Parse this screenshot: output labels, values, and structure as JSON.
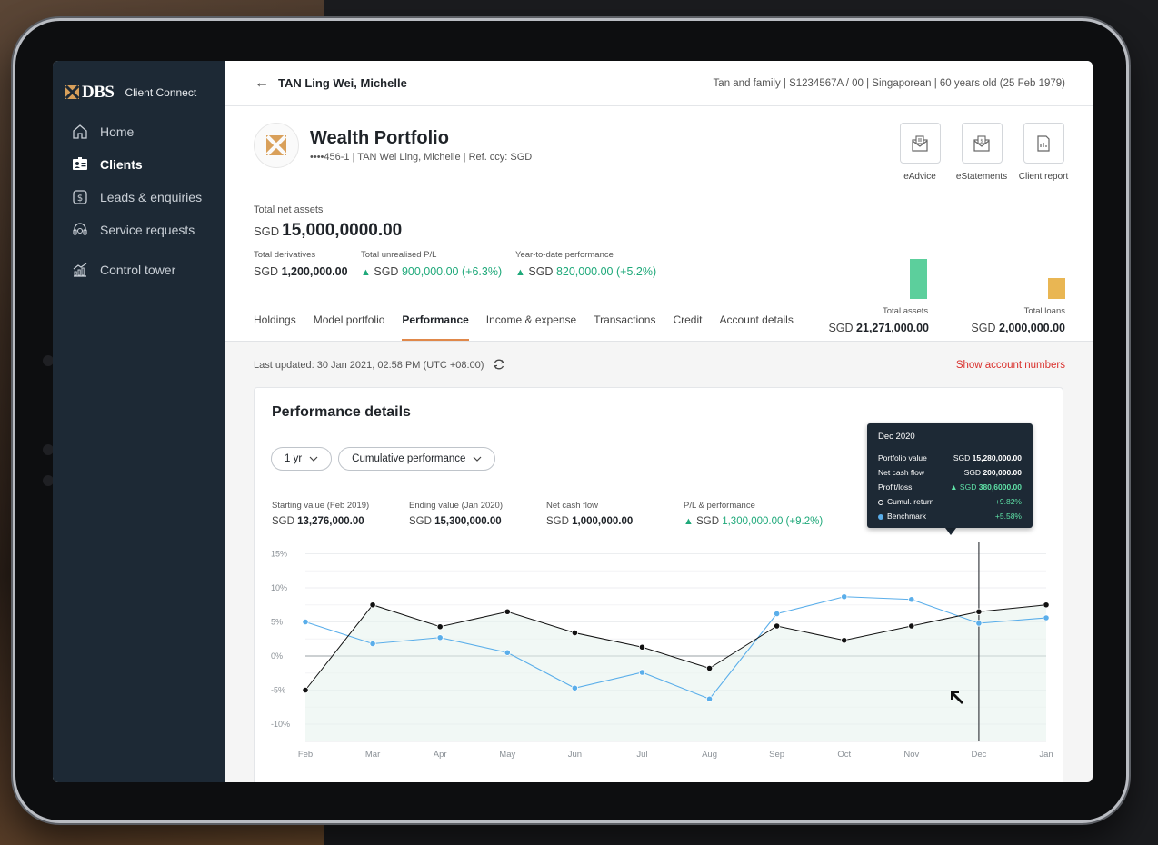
{
  "app": {
    "brand": "DBS",
    "brand_sub": "Client Connect"
  },
  "sidebar": {
    "items": [
      {
        "label": "Home",
        "icon": "home-icon"
      },
      {
        "label": "Clients",
        "icon": "id-card-icon"
      },
      {
        "label": "Leads & enquiries",
        "icon": "dollar-tag-icon"
      },
      {
        "label": "Service requests",
        "icon": "headset-icon"
      },
      {
        "label": "Control tower",
        "icon": "chart-growth-icon"
      }
    ],
    "active_index": 1
  },
  "header": {
    "client_name": "TAN Ling Wei, Michelle",
    "client_meta": "Tan and family | S1234567A / 00 | Singaporean | 60 years old (25 Feb 1979)"
  },
  "portfolio": {
    "title": "Wealth Portfolio",
    "subtitle": "••••456-1 | TAN Wei Ling, Michelle | Ref. ccy: SGD",
    "actions": [
      "eAdvice",
      "eStatements",
      "Client report"
    ],
    "total_net_assets_label": "Total net assets",
    "total_net_assets_ccy": "SGD",
    "total_net_assets_value": "15,000,0000.00",
    "metrics": [
      {
        "label": "Total derivatives",
        "ccy": "SGD",
        "value": "1,200,000.00",
        "positive": false
      },
      {
        "label": "Total unrealised P/L",
        "ccy": "SGD",
        "value": "900,000.00 (+6.3%)",
        "positive": true
      },
      {
        "label": "Year-to-date performance",
        "ccy": "SGD",
        "value": "820,000.00 (+5.2%)",
        "positive": true
      }
    ],
    "total_assets_label": "Total assets",
    "total_assets_ccy": "SGD",
    "total_assets_value": "21,271,000.00",
    "total_loans_label": "Total loans",
    "total_loans_ccy": "SGD",
    "total_loans_value": "2,000,000.00",
    "assets_color": "#5ccf9c",
    "loans_color": "#e9b653"
  },
  "tabs": [
    "Holdings",
    "Model portfolio",
    "Performance",
    "Income & expense",
    "Transactions",
    "Credit",
    "Account details"
  ],
  "active_tab": 2,
  "updated": {
    "text": "Last updated: 30 Jan 2021, 02:58 PM (UTC +08:00)",
    "show_accounts": "Show account numbers"
  },
  "performance": {
    "title": "Performance details",
    "period": "1 yr",
    "mode": "Cumulative performance",
    "stats": [
      {
        "label": "Starting value (Feb 2019)",
        "ccy": "SGD",
        "value": "13,276,000.00",
        "positive": false
      },
      {
        "label": "Ending value (Jan 2020)",
        "ccy": "SGD",
        "value": "15,300,000.00",
        "positive": false
      },
      {
        "label": "Net cash flow",
        "ccy": "SGD",
        "value": "1,000,000.00",
        "positive": false
      },
      {
        "label": "P/L & performance",
        "ccy": "SGD",
        "value": "1,300,000.00 (+9.2%)",
        "positive": true
      }
    ],
    "tooltip": {
      "title": "Dec 2020",
      "rows": [
        {
          "label": "Portfolio value",
          "ccy": "SGD",
          "value": "15,280,000.00"
        },
        {
          "label": "Net cash flow",
          "ccy": "SGD",
          "value": "200,000.00"
        },
        {
          "label": "Profit/loss",
          "ccy": "SGD",
          "value": "380,6000.00",
          "positive": true
        },
        {
          "label": "Cumul. return",
          "value": "+9.82%",
          "marker": "hollow"
        },
        {
          "label": "Benchmark",
          "value": "+5.58%",
          "marker": "blue"
        }
      ]
    }
  },
  "chart_data": {
    "type": "line",
    "categories": [
      "Feb",
      "Mar",
      "Apr",
      "May",
      "Jun",
      "Jul",
      "Aug",
      "Sep",
      "Oct",
      "Nov",
      "Dec",
      "Jan"
    ],
    "y_ticks": [
      "15%",
      "10%",
      "5%",
      "0%",
      "-5%",
      "-10%"
    ],
    "ylim": [
      -12.5,
      15
    ],
    "series": [
      {
        "name": "Cumul. return",
        "color": "#111111",
        "values": [
          -5,
          7.5,
          4.3,
          6.5,
          3.4,
          1.3,
          -1.8,
          4.4,
          2.3,
          4.4,
          6.5,
          7.5
        ]
      },
      {
        "name": "Benchmark",
        "color": "#5aaeea",
        "values": [
          5,
          1.8,
          2.7,
          0.5,
          -4.7,
          -2.4,
          -6.3,
          6.2,
          8.7,
          8.3,
          4.8,
          5.6
        ]
      }
    ],
    "highlight_category": "Dec",
    "grid": true
  }
}
